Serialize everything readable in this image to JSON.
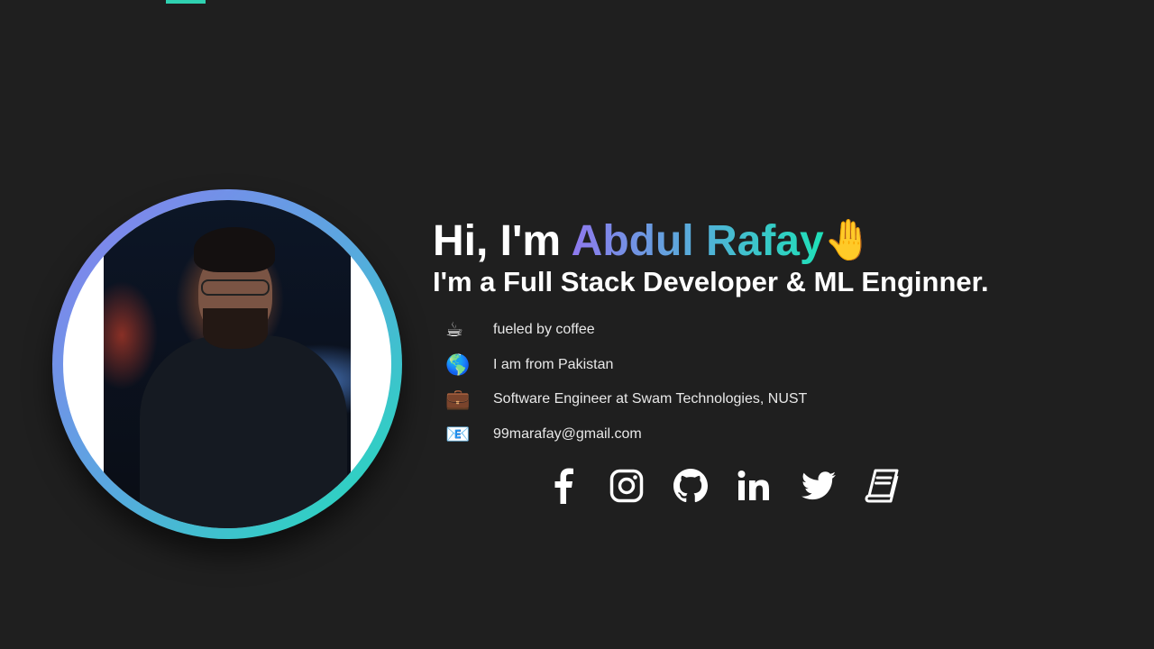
{
  "header": {
    "greeting_prefix": "Hi, I'm ",
    "name": "Abdul Rafay",
    "wave_emoji": "🤚",
    "subtitle": "I'm a Full Stack Developer & ML Enginner."
  },
  "facts": [
    {
      "icon": "☕",
      "icon_name": "coffee-icon",
      "text": "fueled by coffee"
    },
    {
      "icon": "🌎",
      "icon_name": "globe-icon",
      "text": "I am from Pakistan"
    },
    {
      "icon": "💼",
      "icon_name": "briefcase-icon",
      "text": "Software Engineer at Swam Technologies, NUST"
    },
    {
      "icon": "📧",
      "icon_name": "email-icon",
      "text": "99marafay@gmail.com"
    }
  ],
  "socials": [
    {
      "icon_name": "facebook-icon"
    },
    {
      "icon_name": "instagram-icon"
    },
    {
      "icon_name": "github-icon"
    },
    {
      "icon_name": "linkedin-icon"
    },
    {
      "icon_name": "twitter-icon"
    },
    {
      "icon_name": "book-icon"
    }
  ],
  "colors": {
    "background": "#1f1f1f",
    "accent_start": "#8a7cf0",
    "accent_end": "#1fe0b8",
    "text": "#ffffff"
  }
}
